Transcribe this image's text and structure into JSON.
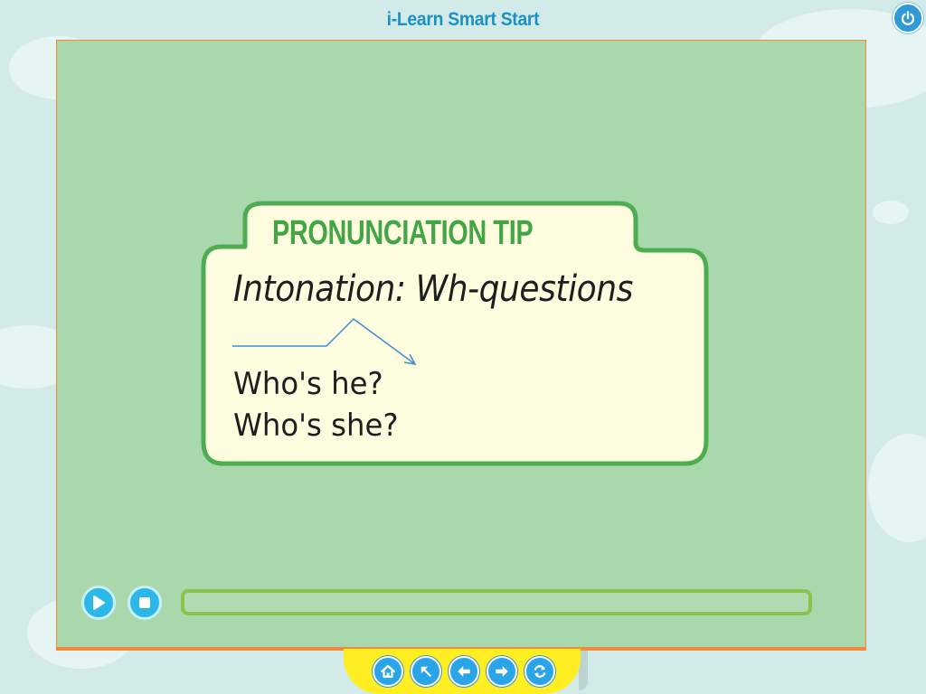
{
  "app": {
    "title": "i-Learn Smart Start"
  },
  "tip": {
    "heading": "PRONUNCIATION TIP",
    "subtitle": "Intonation: Wh-questions",
    "lines": [
      "Who's he?",
      "Who's she?"
    ]
  },
  "player": {
    "progress": 0
  },
  "nav": {
    "buttons": [
      "home",
      "up-left",
      "back",
      "forward",
      "replay"
    ]
  },
  "colors": {
    "stage": "#aad8ad",
    "card": "#fffde0",
    "card_border": "#4cae4f",
    "accent_blue": "#2bb8e6",
    "nav_yellow": "#ffee22"
  }
}
